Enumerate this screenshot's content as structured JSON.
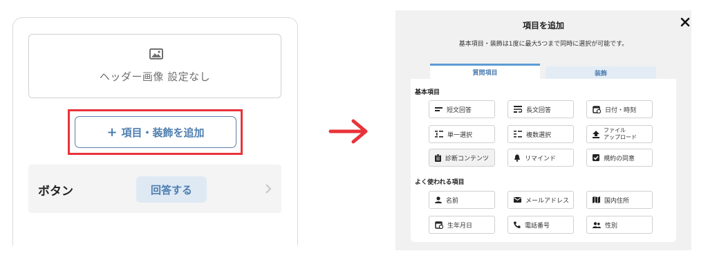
{
  "left": {
    "header_image_label": "ヘッダー画像 設定なし",
    "add_button_plus": "+",
    "add_button_label": "項目・装飾を追加",
    "button_row_label": "ボタン",
    "answer_button_label": "回答する"
  },
  "modal": {
    "title": "項目を追加",
    "subtitle": "基本項目・装飾は1度に最大5つまで同時に選択が可能です。",
    "tabs": [
      {
        "label": "質問項目",
        "active": true
      },
      {
        "label": "装飾",
        "active": false
      }
    ],
    "basic_section_label": "基本項目",
    "basic_items": [
      {
        "label": "短文回答",
        "icon": "short-text-icon"
      },
      {
        "label": "長文回答",
        "icon": "long-text-icon"
      },
      {
        "label": "日付・時刻",
        "icon": "calendar-clock-icon"
      },
      {
        "label": "単一選択",
        "icon": "single-select-icon"
      },
      {
        "label": "複数選択",
        "icon": "multi-select-icon"
      },
      {
        "label": "ファイル\nアップロード",
        "icon": "upload-icon"
      },
      {
        "label": "診断コンテンツ",
        "icon": "clipboard-icon"
      },
      {
        "label": "リマインド",
        "icon": "bell-icon"
      },
      {
        "label": "規約の同意",
        "icon": "checkbox-icon"
      }
    ],
    "common_section_label": "よく使われる項目",
    "common_items": [
      {
        "label": "名前",
        "icon": "person-icon"
      },
      {
        "label": "メールアドレス",
        "icon": "mail-icon"
      },
      {
        "label": "国内住所",
        "icon": "map-icon"
      },
      {
        "label": "生年月日",
        "icon": "birthday-calendar-icon"
      },
      {
        "label": "電話番号",
        "icon": "phone-icon"
      },
      {
        "label": "性別",
        "icon": "people-icon"
      }
    ]
  },
  "colors": {
    "accent_blue": "#4d7eb0",
    "highlight_red": "#e8333a",
    "arrow_red": "#e8333a",
    "tab_active_border": "#5b9bd5"
  }
}
